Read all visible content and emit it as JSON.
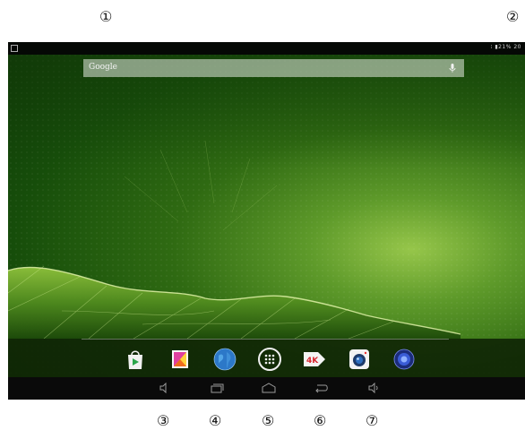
{
  "callouts": [
    "①",
    "②",
    "③",
    "④",
    "⑤",
    "⑥",
    "⑦"
  ],
  "status_bar": {
    "right_text": "⁝ ▮21% 20"
  },
  "search_bar": {
    "label": "Google"
  },
  "dock": {
    "apps": [
      {
        "icon": "play-store-icon"
      },
      {
        "icon": "gallery-icon"
      },
      {
        "icon": "browser-globe-icon"
      },
      {
        "icon": "app-drawer-icon"
      },
      {
        "icon": "4k-player-icon",
        "label": "4K"
      },
      {
        "icon": "camera-icon"
      },
      {
        "icon": "music-speaker-icon"
      }
    ]
  },
  "nav_bar": {
    "buttons": [
      "volume-down-icon",
      "recent-apps-icon",
      "home-icon",
      "back-icon",
      "volume-up-icon"
    ]
  },
  "colors": {
    "wallpaper_dark": "#164d0a",
    "wallpaper_light": "#96c64a",
    "bars": "#0a0a0a"
  }
}
